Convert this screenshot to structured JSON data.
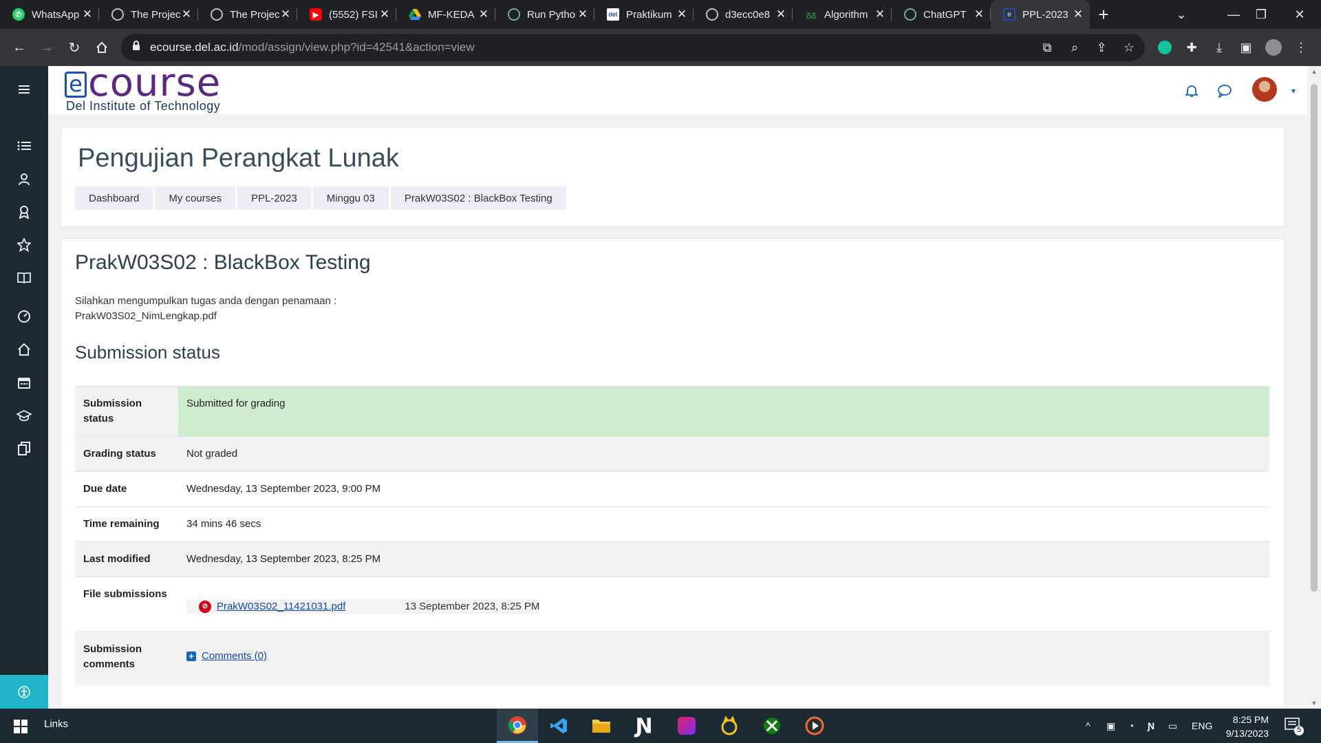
{
  "browser": {
    "tabs": [
      {
        "title": "WhatsApp",
        "icon": "whatsapp-icon",
        "color": "#25d366"
      },
      {
        "title": "The Projec",
        "icon": "globe-icon",
        "color": "#9aa0a6"
      },
      {
        "title": "The Projec",
        "icon": "globe-icon",
        "color": "#9aa0a6"
      },
      {
        "title": "(5552) FSI",
        "icon": "youtube-icon",
        "color": "#ff0000"
      },
      {
        "title": "MF-KEDA",
        "icon": "google-drive-icon",
        "color": "#fbbc04"
      },
      {
        "title": "Run Pytho",
        "icon": "chatgpt-icon",
        "color": "#74aa9c"
      },
      {
        "title": "Praktikum",
        "icon": "del-icon",
        "color": "#1d4fb0"
      },
      {
        "title": "d3ecc0e8",
        "icon": "globe-icon",
        "color": "#9aa0a6"
      },
      {
        "title": "Algorithm",
        "icon": "geeks-icon",
        "color": "#2f8d46"
      },
      {
        "title": "ChatGPT",
        "icon": "chatgpt-icon",
        "color": "#74aa9c"
      },
      {
        "title": "PPL-2023",
        "icon": "ecourse-icon",
        "color": "#1d4fb0",
        "active": true
      }
    ],
    "url_host": "ecourse.del.ac.id",
    "url_path": "/mod/assign/view.php?id=42541&action=view"
  },
  "site": {
    "logo_main": "course",
    "logo_e": "e",
    "logo_sub": "Del Institute of Technology"
  },
  "rail": {
    "items": [
      "menu-icon",
      "list-icon",
      "participants-icon",
      "badges-icon",
      "star-icon",
      "book-icon",
      "dashboard-icon",
      "home-icon",
      "calendar-icon",
      "graduation-icon",
      "files-icon"
    ]
  },
  "page": {
    "course_title": "Pengujian Perangkat Lunak",
    "breadcrumbs": [
      "Dashboard",
      "My courses",
      "PPL-2023",
      "Minggu 03",
      "PrakW03S02 : BlackBox Testing"
    ],
    "assignment_title": "PrakW03S02 : BlackBox Testing",
    "intro_line1": "Silahkan mengumpulkan tugas anda dengan penamaan :",
    "intro_line2": "PrakW03S02_NimLengkap.pdf",
    "submission_heading": "Submission status",
    "rows": {
      "submission_status_label": "Submission status",
      "submission_status_value": "Submitted for grading",
      "grading_status_label": "Grading status",
      "grading_status_value": "Not graded",
      "due_date_label": "Due date",
      "due_date_value": "Wednesday, 13 September 2023, 9:00 PM",
      "time_remaining_label": "Time remaining",
      "time_remaining_value": "34 mins 46 secs",
      "last_modified_label": "Last modified",
      "last_modified_value": "Wednesday, 13 September 2023, 8:25 PM",
      "file_submissions_label": "File submissions",
      "file_name": "PrakW03S02_11421031.pdf",
      "file_date": "13 September 2023, 8:25 PM",
      "comments_label": "Submission comments",
      "comments_link": "Comments (0)"
    }
  },
  "taskbar": {
    "links_label": "Links",
    "language": "ENG",
    "time": "8:25 PM",
    "date": "9/13/2023",
    "notification_count": "5"
  },
  "colors": {
    "accent": "#0f47ad",
    "submitted_green": "#cfeccf",
    "rail_bg": "#1e2a33",
    "accessibility": "#22b5c9"
  }
}
